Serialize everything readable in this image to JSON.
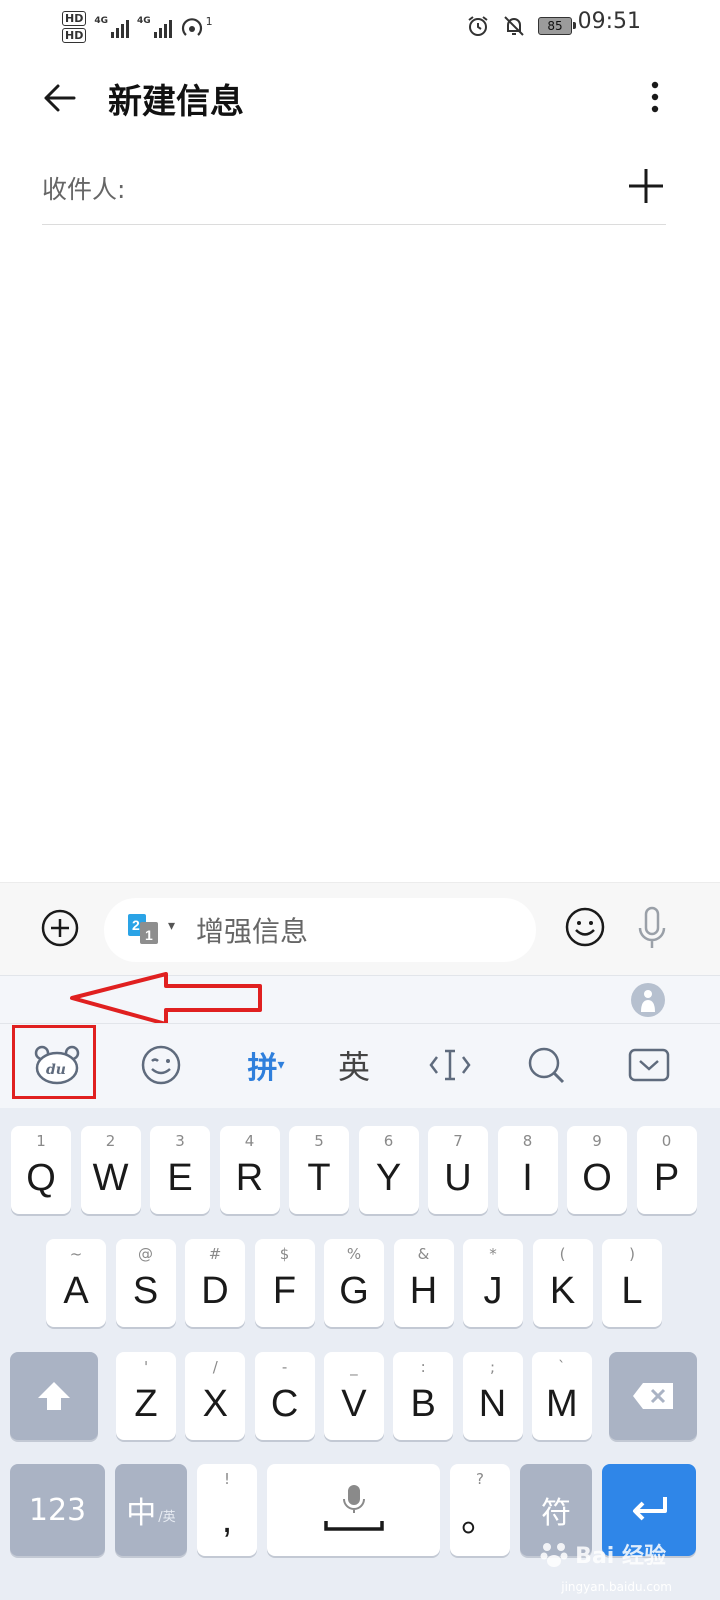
{
  "status_bar": {
    "hd_sim1": "HD",
    "hd_sim2": "HD",
    "network1": "4G",
    "network2": "4G",
    "hotspot_count": "1",
    "battery": "85",
    "time": "09:51"
  },
  "header": {
    "title": "新建信息"
  },
  "recipient": {
    "label": "收件人:"
  },
  "compose": {
    "sim_badge": "21",
    "placeholder": "增强信息"
  },
  "toolbar": {
    "pinyin": "拼",
    "english": "英"
  },
  "keyboard": {
    "row1": [
      {
        "key": "Q",
        "hint": "1"
      },
      {
        "key": "W",
        "hint": "2"
      },
      {
        "key": "E",
        "hint": "3"
      },
      {
        "key": "R",
        "hint": "4"
      },
      {
        "key": "T",
        "hint": "5"
      },
      {
        "key": "Y",
        "hint": "6"
      },
      {
        "key": "U",
        "hint": "7"
      },
      {
        "key": "I",
        "hint": "8"
      },
      {
        "key": "O",
        "hint": "9"
      },
      {
        "key": "P",
        "hint": "0"
      }
    ],
    "row2": [
      {
        "key": "A",
        "hint": "~"
      },
      {
        "key": "S",
        "hint": "@"
      },
      {
        "key": "D",
        "hint": "#"
      },
      {
        "key": "F",
        "hint": "$"
      },
      {
        "key": "G",
        "hint": "%"
      },
      {
        "key": "H",
        "hint": "&"
      },
      {
        "key": "J",
        "hint": "*"
      },
      {
        "key": "K",
        "hint": "("
      },
      {
        "key": "L",
        "hint": ")"
      }
    ],
    "row3": [
      {
        "key": "Z",
        "hint": "'"
      },
      {
        "key": "X",
        "hint": "/"
      },
      {
        "key": "C",
        "hint": "-"
      },
      {
        "key": "V",
        "hint": "_"
      },
      {
        "key": "B",
        "hint": ":"
      },
      {
        "key": "N",
        "hint": ";"
      },
      {
        "key": "M",
        "hint": "`"
      }
    ],
    "num_key": "123",
    "lang_key": "中",
    "lang_key_sub": "/英",
    "comma_key": ",",
    "comma_hint": "!",
    "period_key": "。",
    "period_hint": "?",
    "symbol_key": "符"
  },
  "watermark": {
    "brand": "Bai 经验",
    "url": "jingyan.baidu.com"
  },
  "colors": {
    "accent": "#2f86e8",
    "highlight": "#e02020"
  }
}
